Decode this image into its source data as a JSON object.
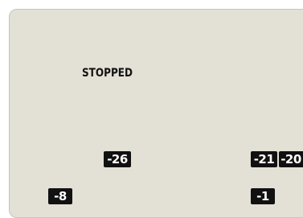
{
  "status_text": "STOPPED",
  "markers": [
    {
      "label": "-26"
    },
    {
      "label": "-21"
    },
    {
      "label": "-20"
    },
    {
      "label": "-8"
    },
    {
      "label": "-1"
    }
  ],
  "colors": {
    "panel_bg": "#e3e0d5",
    "badge_bg": "#111111",
    "badge_text": "#ffffff"
  }
}
